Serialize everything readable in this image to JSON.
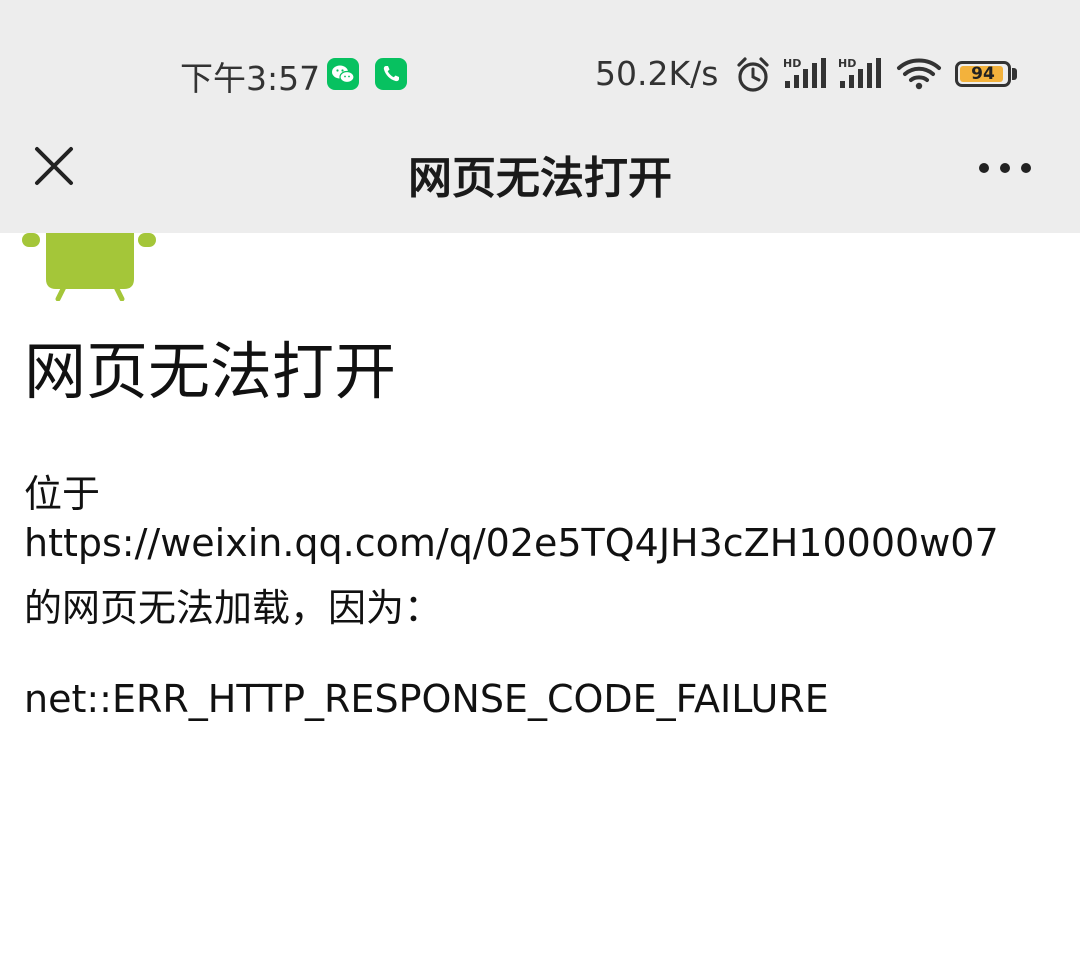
{
  "status_bar": {
    "time": "下午3:57",
    "network_speed": "50.2K/s",
    "battery_level": "94",
    "battery_percent": 94,
    "notification_icons": [
      "wechat-icon",
      "phone-icon"
    ],
    "system_icons": [
      "alarm-icon",
      "hd-signal-icon",
      "hd-signal-icon",
      "wifi-icon",
      "battery-icon"
    ],
    "accent_color": "#07c160",
    "battery_color": "#f3b23c"
  },
  "nav_bar": {
    "title": "网页无法打开",
    "left_icon": "close-icon",
    "right_icon": "more-icon"
  },
  "content": {
    "logo": "android-icon",
    "logo_color": "#a4c639",
    "title": "网页无法打开",
    "message_prefix": "位于",
    "url": "https://weixin.qq.com/q/02e5TQ4JH3cZH10000w07",
    "message_suffix": "的网页无法加载，因为：",
    "error_code": "net::ERR_HTTP_RESPONSE_CODE_FAILURE"
  }
}
